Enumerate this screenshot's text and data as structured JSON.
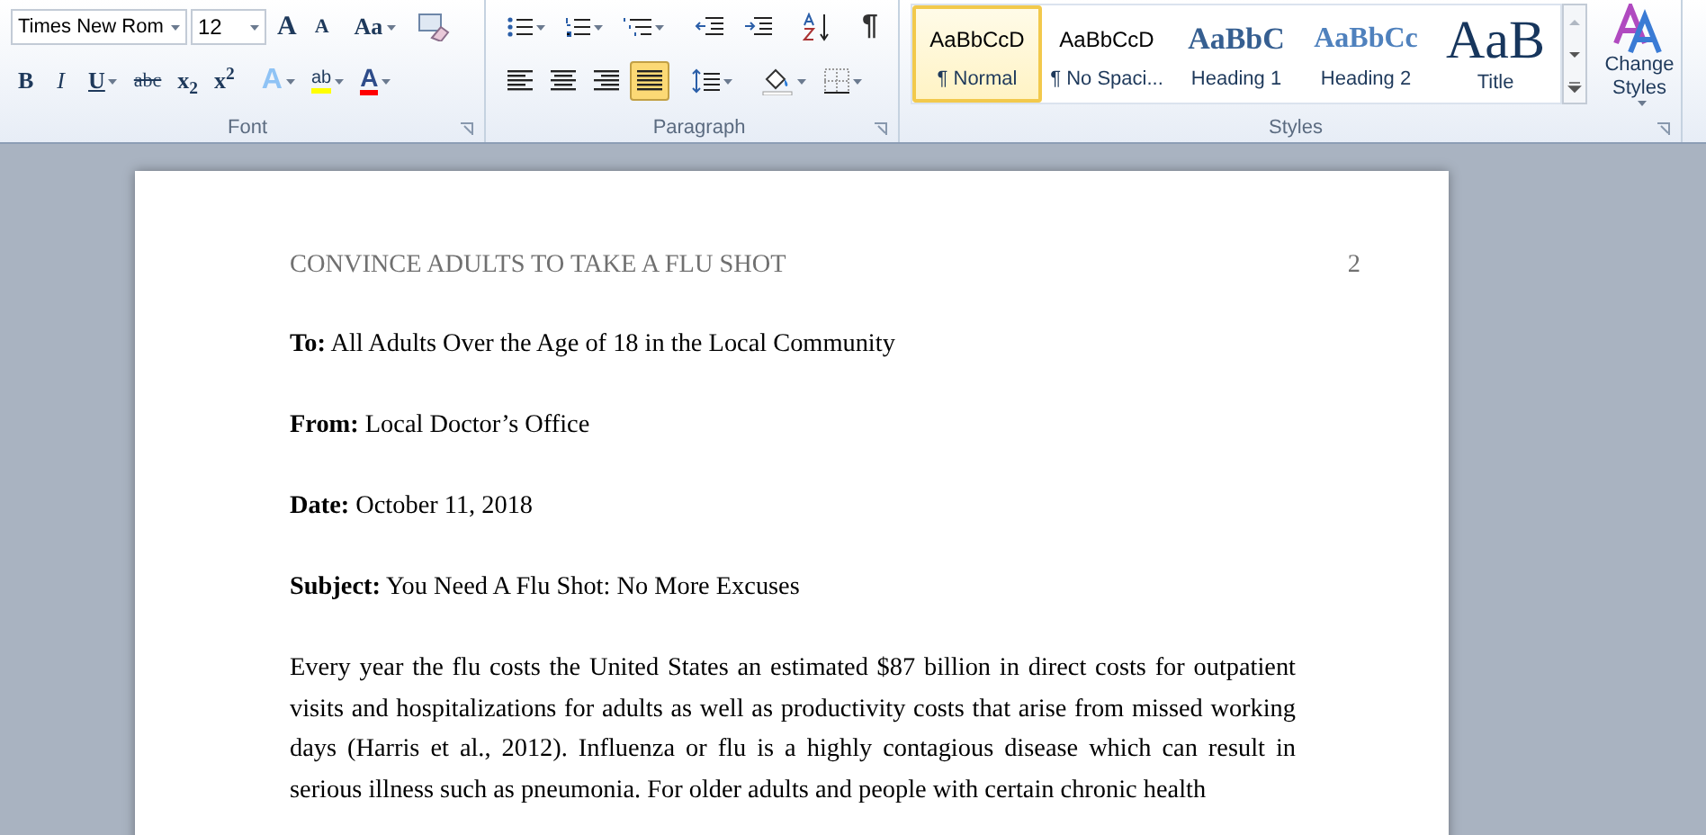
{
  "ribbon": {
    "font": {
      "label": "Font",
      "font_name": "Times New Rom",
      "font_size": "12",
      "grow": "A",
      "shrink": "A",
      "change_case": "Aa",
      "bold": "B",
      "italic": "I",
      "underline": "U",
      "strikethrough": "abc",
      "subscript": "x$_{2}$",
      "superscript": "x$^{2}$",
      "text_effects": "A",
      "highlight": "ab",
      "font_color": "A"
    },
    "paragraph": {
      "label": "Paragraph",
      "show_marks": "¶",
      "alignment": [
        {
          "selected": false
        },
        {
          "selected": false
        },
        {
          "selected": false
        },
        {
          "selected": true
        }
      ]
    },
    "styles": {
      "label": "Styles",
      "gallery": [
        {
          "preview": "AaBbCcD",
          "name": "¶ Normal",
          "kind": "normal",
          "selected": true
        },
        {
          "preview": "AaBbCcD",
          "name": "¶ No Spaci...",
          "kind": "normal",
          "selected": false
        },
        {
          "preview": "AaBbC",
          "name": "Heading 1",
          "kind": "heading1",
          "selected": false
        },
        {
          "preview": "AaBbCc",
          "name": "Heading 2",
          "kind": "heading2",
          "selected": false
        },
        {
          "preview": "AaB",
          "name": "Title",
          "kind": "title",
          "selected": false
        }
      ],
      "change_styles": "Change Styles"
    }
  },
  "document": {
    "header": "CONVINCE ADULTS TO TAKE A FLU SHOT",
    "page_number": "2",
    "paragraphs": [
      "**To:** All Adults Over the Age of 18 in the Local Community",
      "**From:** Local Doctor’s Office",
      "**Date:** October 11, 2018",
      "**Subject:** You Need A Flu Shot: No More Excuses",
      "Every year the flu costs the United States an estimated $87 billion in direct costs for outpatient visits and hospitalizations for adults as well as productivity costs that arise from missed working days (Harris et al., 2012). Influenza or flu is a highly contagious disease which can result in serious illness such as pneumonia. For older adults and people with certain chronic health"
    ]
  }
}
